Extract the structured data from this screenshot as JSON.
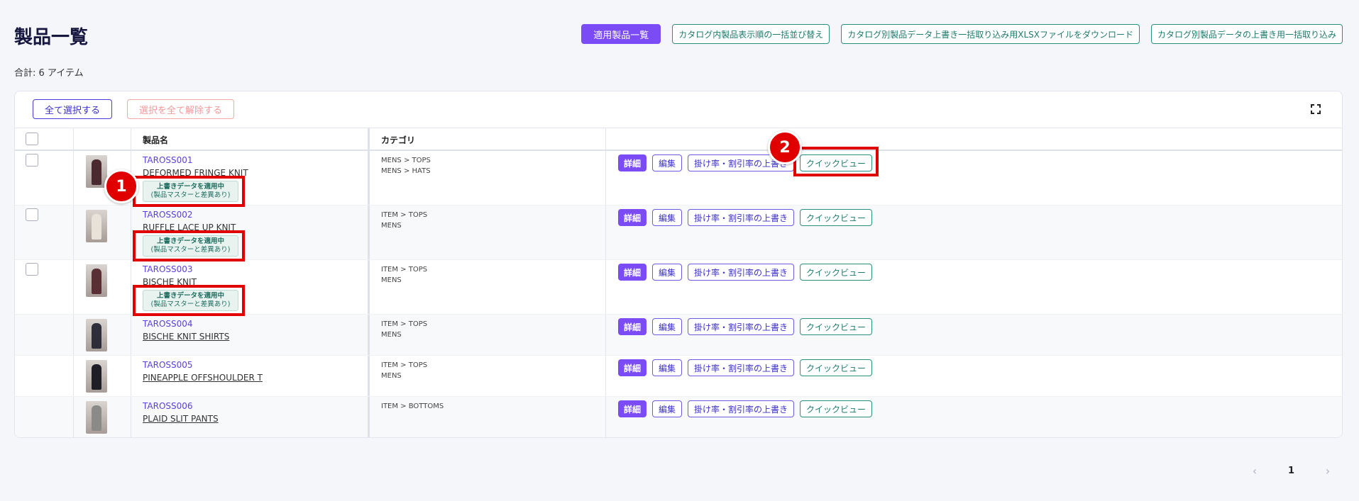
{
  "page": {
    "title": "製品一覧",
    "total_label": "合計:",
    "total_value": "6 アイテム"
  },
  "top_actions": {
    "applied_products": "適用製品一覧",
    "bulk_reorder": "カタログ内製品表示順の一括並び替え",
    "download_xlsx": "カタログ別製品データ上書き一括取り込み用XLSXファイルをダウンロード",
    "bulk_import": "カタログ別製品データの上書き用一括取り込み"
  },
  "toolbar": {
    "select_all": "全て選択する",
    "deselect_all": "選択を全て解除する"
  },
  "table": {
    "headers": {
      "name": "製品名",
      "category": "カテゴリ"
    },
    "action_labels": {
      "detail": "詳細",
      "edit": "編集",
      "override_rate": "掛け率・割引率の上書き",
      "quick_view": "クイックビュー"
    },
    "badge": {
      "line1": "上書きデータを適用中",
      "line2": "(製品マスターと差異あり)"
    },
    "rows": [
      {
        "code": "TAROSS001",
        "name": "DEFORMED FRINGE KNIT",
        "cat1": "MENS > TOPS",
        "cat2": "MENS > HATS",
        "has_checkbox": true,
        "override": true,
        "img_color": "#4a2a30"
      },
      {
        "code": "TAROSS002",
        "name": "RUFFLE LACE UP KNIT",
        "cat1": "ITEM > TOPS",
        "cat2": "MENS",
        "has_checkbox": true,
        "override": true,
        "img_color": "#e8e2d8"
      },
      {
        "code": "TAROSS003",
        "name": "BISCHE KNIT",
        "cat1": "ITEM > TOPS",
        "cat2": "MENS",
        "has_checkbox": true,
        "override": true,
        "img_color": "#5a2f34"
      },
      {
        "code": "TAROSS004",
        "name": "BISCHE KNIT SHIRTS",
        "cat1": "ITEM > TOPS",
        "cat2": "MENS",
        "has_checkbox": false,
        "override": false,
        "img_color": "#2e2e3a"
      },
      {
        "code": "TAROSS005",
        "name": "PINEAPPLE OFFSHOULDER T",
        "cat1": "ITEM > TOPS",
        "cat2": "MENS",
        "has_checkbox": false,
        "override": false,
        "img_color": "#1e1e26"
      },
      {
        "code": "TAROSS006",
        "name": "PLAID SLIT PANTS",
        "cat1": "ITEM > BOTTOMS",
        "cat2": "",
        "has_checkbox": false,
        "override": false,
        "img_color": "#8a8a88"
      }
    ]
  },
  "annotations": {
    "marker1": "1",
    "marker2": "2"
  },
  "pagination": {
    "current": "1"
  }
}
